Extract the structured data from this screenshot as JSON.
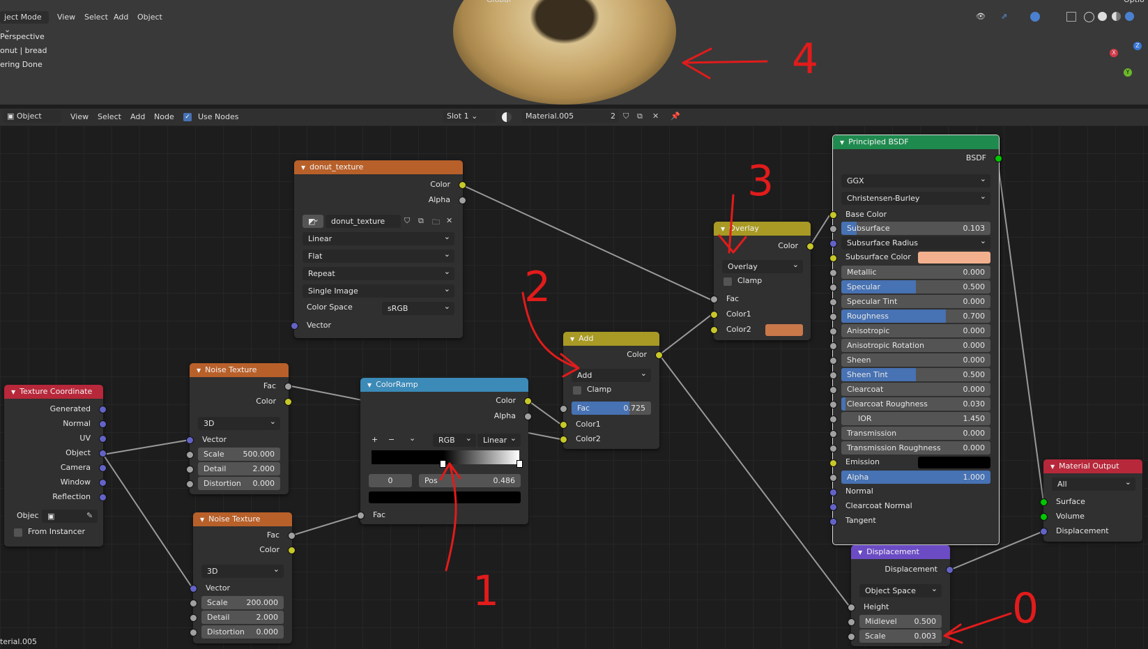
{
  "viewport": {
    "mode_label": "ject Mode",
    "menus": [
      "View",
      "Select",
      "Add",
      "Object"
    ],
    "transform": "Global",
    "options_label": "Optio",
    "info": [
      "Perspective",
      "onut | bread",
      "ering Done"
    ],
    "gizmo": {
      "x": "X",
      "y": "Y",
      "z": "Z"
    }
  },
  "node_header": {
    "editor_type": "Object",
    "menus": [
      "View",
      "Select",
      "Add",
      "Node"
    ],
    "use_nodes_label": "Use Nodes",
    "slot": "Slot 1",
    "material": "Material.005",
    "users": "2"
  },
  "nodes": {
    "image_texture": {
      "title": "donut_texture",
      "outputs": [
        "Color",
        "Alpha"
      ],
      "image_name": "donut_texture",
      "interpolation": "Linear",
      "projection": "Flat",
      "extension": "Repeat",
      "source": "Single Image",
      "color_space_label": "Color Space",
      "color_space": "sRGB",
      "input": "Vector"
    },
    "texture_coordinate": {
      "title": "Texture Coordinate",
      "outputs": [
        "Generated",
        "Normal",
        "UV",
        "Object",
        "Camera",
        "Window",
        "Reflection"
      ],
      "object_label": "Objec",
      "from_instancer": "From Instancer"
    },
    "noise1": {
      "title": "Noise Texture",
      "outputs": [
        "Fac",
        "Color"
      ],
      "dimensions": "3D",
      "input_vector": "Vector",
      "scale_label": "Scale",
      "scale": "500.000",
      "detail_label": "Detail",
      "detail": "2.000",
      "distortion_label": "Distortion",
      "distortion": "0.000"
    },
    "noise2": {
      "title": "Noise Texture",
      "outputs": [
        "Fac",
        "Color"
      ],
      "dimensions": "3D",
      "input_vector": "Vector",
      "scale_label": "Scale",
      "scale": "200.000",
      "detail_label": "Detail",
      "detail": "2.000",
      "distortion_label": "Distortion",
      "distortion": "0.000"
    },
    "colorramp": {
      "title": "ColorRamp",
      "outputs": [
        "Color",
        "Alpha"
      ],
      "buttons": [
        "+",
        "−",
        "⌄"
      ],
      "color_mode": "RGB",
      "interpolation": "Linear",
      "stop_index": "0",
      "pos_label": "Pos",
      "pos": "0.486",
      "input": "Fac"
    },
    "add": {
      "title": "Add",
      "output": "Color",
      "blend": "Add",
      "clamp": "Clamp",
      "fac_label": "Fac",
      "fac": "0.725",
      "fac_fraction": 0.725,
      "inputs": [
        "Color1",
        "Color2"
      ]
    },
    "overlay": {
      "title": "Overlay",
      "output": "Color",
      "blend": "Overlay",
      "clamp": "Clamp",
      "inputs": [
        "Fac",
        "Color1",
        "Color2"
      ],
      "color2": "#c9784a"
    },
    "bsdf": {
      "title": "Principled BSDF",
      "output": "BSDF",
      "distribution": "GGX",
      "subsurface_method": "Christensen-Burley",
      "base_color_label": "Base Color",
      "subsurface_radius": "Subsurface Radius",
      "subsurface_color_label": "Subsurface Color",
      "subsurface_color": "#f2b08e",
      "emission_label": "Emission",
      "emission_color": "#000000",
      "sliders": [
        {
          "label": "Subsurface",
          "value": "0.103",
          "fraction": 0.103
        },
        {
          "label": "Metallic",
          "value": "0.000",
          "fraction": 0
        },
        {
          "label": "Specular",
          "value": "0.500",
          "fraction": 0.5
        },
        {
          "label": "Specular Tint",
          "value": "0.000",
          "fraction": 0
        },
        {
          "label": "Roughness",
          "value": "0.700",
          "fraction": 0.7
        },
        {
          "label": "Anisotropic",
          "value": "0.000",
          "fraction": 0
        },
        {
          "label": "Anisotropic Rotation",
          "value": "0.000",
          "fraction": 0
        },
        {
          "label": "Sheen",
          "value": "0.000",
          "fraction": 0
        },
        {
          "label": "Sheen Tint",
          "value": "0.500",
          "fraction": 0.5
        },
        {
          "label": "Clearcoat",
          "value": "0.000",
          "fraction": 0
        },
        {
          "label": "Clearcoat Roughness",
          "value": "0.030",
          "fraction": 0.03
        },
        {
          "label": "IOR",
          "value": "1.450",
          "fraction": 0
        },
        {
          "label": "Transmission",
          "value": "0.000",
          "fraction": 0
        },
        {
          "label": "Transmission Roughness",
          "value": "0.000",
          "fraction": 0
        }
      ],
      "alpha_label": "Alpha",
      "alpha": "1.000",
      "vector_inputs": [
        "Normal",
        "Clearcoat Normal",
        "Tangent"
      ]
    },
    "material_output": {
      "title": "Material Output",
      "target": "All",
      "inputs": [
        "Surface",
        "Volume",
        "Displacement"
      ]
    },
    "displacement": {
      "title": "Displacement",
      "output": "Displacement",
      "space": "Object Space",
      "height": "Height",
      "midlevel_label": "Midlevel",
      "midlevel": "0.500",
      "scale_label": "Scale",
      "scale": "0.003"
    }
  },
  "annotations": [
    "4",
    "3",
    "2",
    "1",
    "0"
  ],
  "status_text": "terial.005",
  "colors": {
    "accent_slider": "#4772b3",
    "header_texture": "#b8602a",
    "header_color": "#a89a24",
    "header_shader": "#1e8a4e",
    "header_output": "#b7283a",
    "header_vector": "#6b4cc4",
    "header_converter": "#3b8ab8",
    "annotation": "#e21b1b"
  }
}
